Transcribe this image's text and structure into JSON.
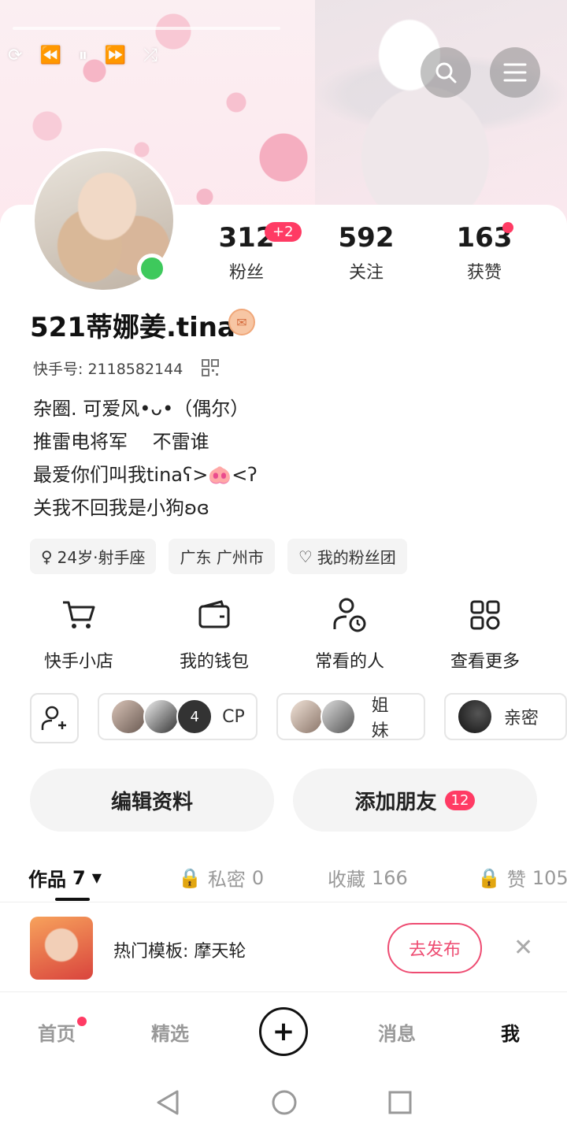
{
  "stats": {
    "fans": {
      "value": "312",
      "label": "粉丝",
      "badge": "+2"
    },
    "following": {
      "value": "592",
      "label": "关注"
    },
    "likes": {
      "value": "163",
      "label": "获赞"
    }
  },
  "profile": {
    "name": "521蒂娜姜.tina",
    "uid": "快手号: 2118582144",
    "bio": [
      "杂圈. 可爱风•ᴗ•（偶尔）",
      "推雷电将军　 不雷谁",
      "最爱你们叫我tinaʕ>🐽<ʔ",
      "关我不回我是小狗ʚɞ"
    ]
  },
  "tags": [
    "24岁·射手座",
    "广东 广州市",
    "我的粉丝团"
  ],
  "tools": [
    {
      "label": "快手小店",
      "icon": "cart-icon"
    },
    {
      "label": "我的钱包",
      "icon": "wallet-icon"
    },
    {
      "label": "常看的人",
      "icon": "recent-user-icon"
    },
    {
      "label": "查看更多",
      "icon": "grid-icon"
    }
  ],
  "groups": [
    {
      "label": "CP",
      "extra": "4"
    },
    {
      "label": "姐妹"
    },
    {
      "label": "亲密"
    }
  ],
  "buttons": {
    "edit": "编辑资料",
    "add_friend": "添加朋友",
    "add_friend_badge": "12"
  },
  "tabs": [
    {
      "label": "作品",
      "count": "7"
    },
    {
      "label": "私密",
      "count": "0"
    },
    {
      "label": "收藏",
      "count": "166"
    },
    {
      "label": "赞",
      "count": "105"
    }
  ],
  "promo": {
    "text": "热门模板: 摩天轮",
    "button": "去发布"
  },
  "nav": [
    "首页",
    "精选",
    "消息",
    "我"
  ],
  "colors": {
    "accent": "#ff3b64",
    "online": "#3ec95c"
  }
}
